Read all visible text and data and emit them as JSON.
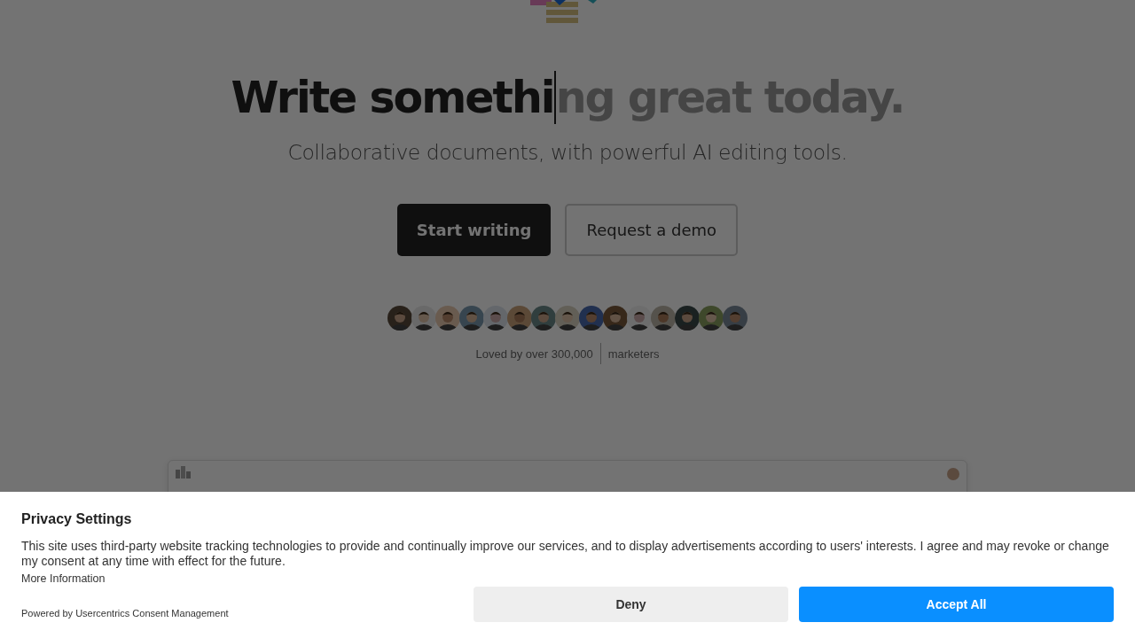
{
  "hero": {
    "headline_typed": "Write somethi",
    "headline_pending": "ng great today.",
    "subtitle": "Collaborative documents, with powerful AI editing tools.",
    "buttons": [
      {
        "label": "Start writing",
        "kind": "primary"
      },
      {
        "label": "Request a demo",
        "kind": "secondary"
      }
    ],
    "social_proof": "Loved by over 300,000",
    "audience": "marketers"
  },
  "consent": {
    "title": "Privacy Settings",
    "text": "This site uses third-party website tracking technologies to provide and continually improve our services, and to display advertisements according to users' interests. I agree and may revoke or change my consent at any time with effect for the future.",
    "more_link": "More Information",
    "powered_by": "Powered by Usercentrics Consent Management",
    "buttons": [
      {
        "label": "Deny",
        "kind": "secondary"
      },
      {
        "label": "Accept All",
        "kind": "primary"
      }
    ]
  }
}
